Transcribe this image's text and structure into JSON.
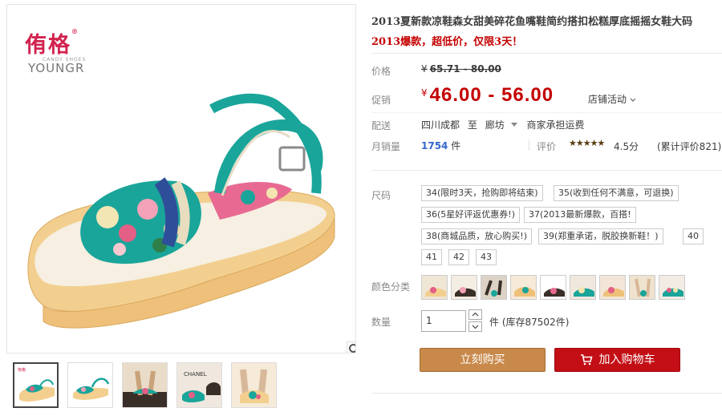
{
  "gallery": {
    "brand_cn": "侑格",
    "brand_reg": "®",
    "brand_sub": "CANDY SHOES",
    "brand_en": "YOUNGR",
    "thumbnails": [
      "thumb-1",
      "thumb-2",
      "thumb-3",
      "thumb-4",
      "thumb-5"
    ]
  },
  "product": {
    "title": "2013夏新款凉鞋森女甜美碎花鱼嘴鞋简约搭扣松糕厚底摇摇女鞋大码",
    "subtitle": "2013爆款，超低价，仅限3天！"
  },
  "price": {
    "label": "价格",
    "yen": "¥",
    "original": "65.71 - 80.00"
  },
  "promo_price": {
    "label": "促销",
    "yen": "¥",
    "value": "46.00 - 56.00",
    "activity": "店铺活动"
  },
  "shipping": {
    "label": "配送",
    "from": "四川成都",
    "to_word": "至",
    "to": "廊坊",
    "fee": "商家承担运费"
  },
  "sales": {
    "label": "月销量",
    "count": "1754",
    "unit": "件",
    "rating_label": "评价",
    "stars": "★★★★★",
    "rating": "4.5分",
    "rating_count": "(累计评价821)"
  },
  "size": {
    "label": "尺码",
    "options": [
      "34(限时3天，抢购即将结束)",
      "35(收到任何不满意，可退换)",
      "36(5星好评返优惠券!)",
      "37(2013最新爆款，百搭!",
      "38(商城品质，放心购买!)",
      "39(郑重承诺，脱胶换新鞋！)",
      "40",
      "41",
      "42",
      "43"
    ]
  },
  "color": {
    "label": "颜色分类",
    "swatch_count": 9
  },
  "quantity": {
    "label": "数量",
    "value": "1",
    "unit": "件",
    "stock": "(库存87502件)"
  },
  "buttons": {
    "buy": "立刻购买",
    "cart": "加入购物车"
  },
  "colors": {
    "price_red": "#c40000",
    "buy_bg": "#c8894a",
    "cart_bg": "#c30e15",
    "brand_pink": "#d2234f",
    "link_blue": "#3366cc"
  }
}
